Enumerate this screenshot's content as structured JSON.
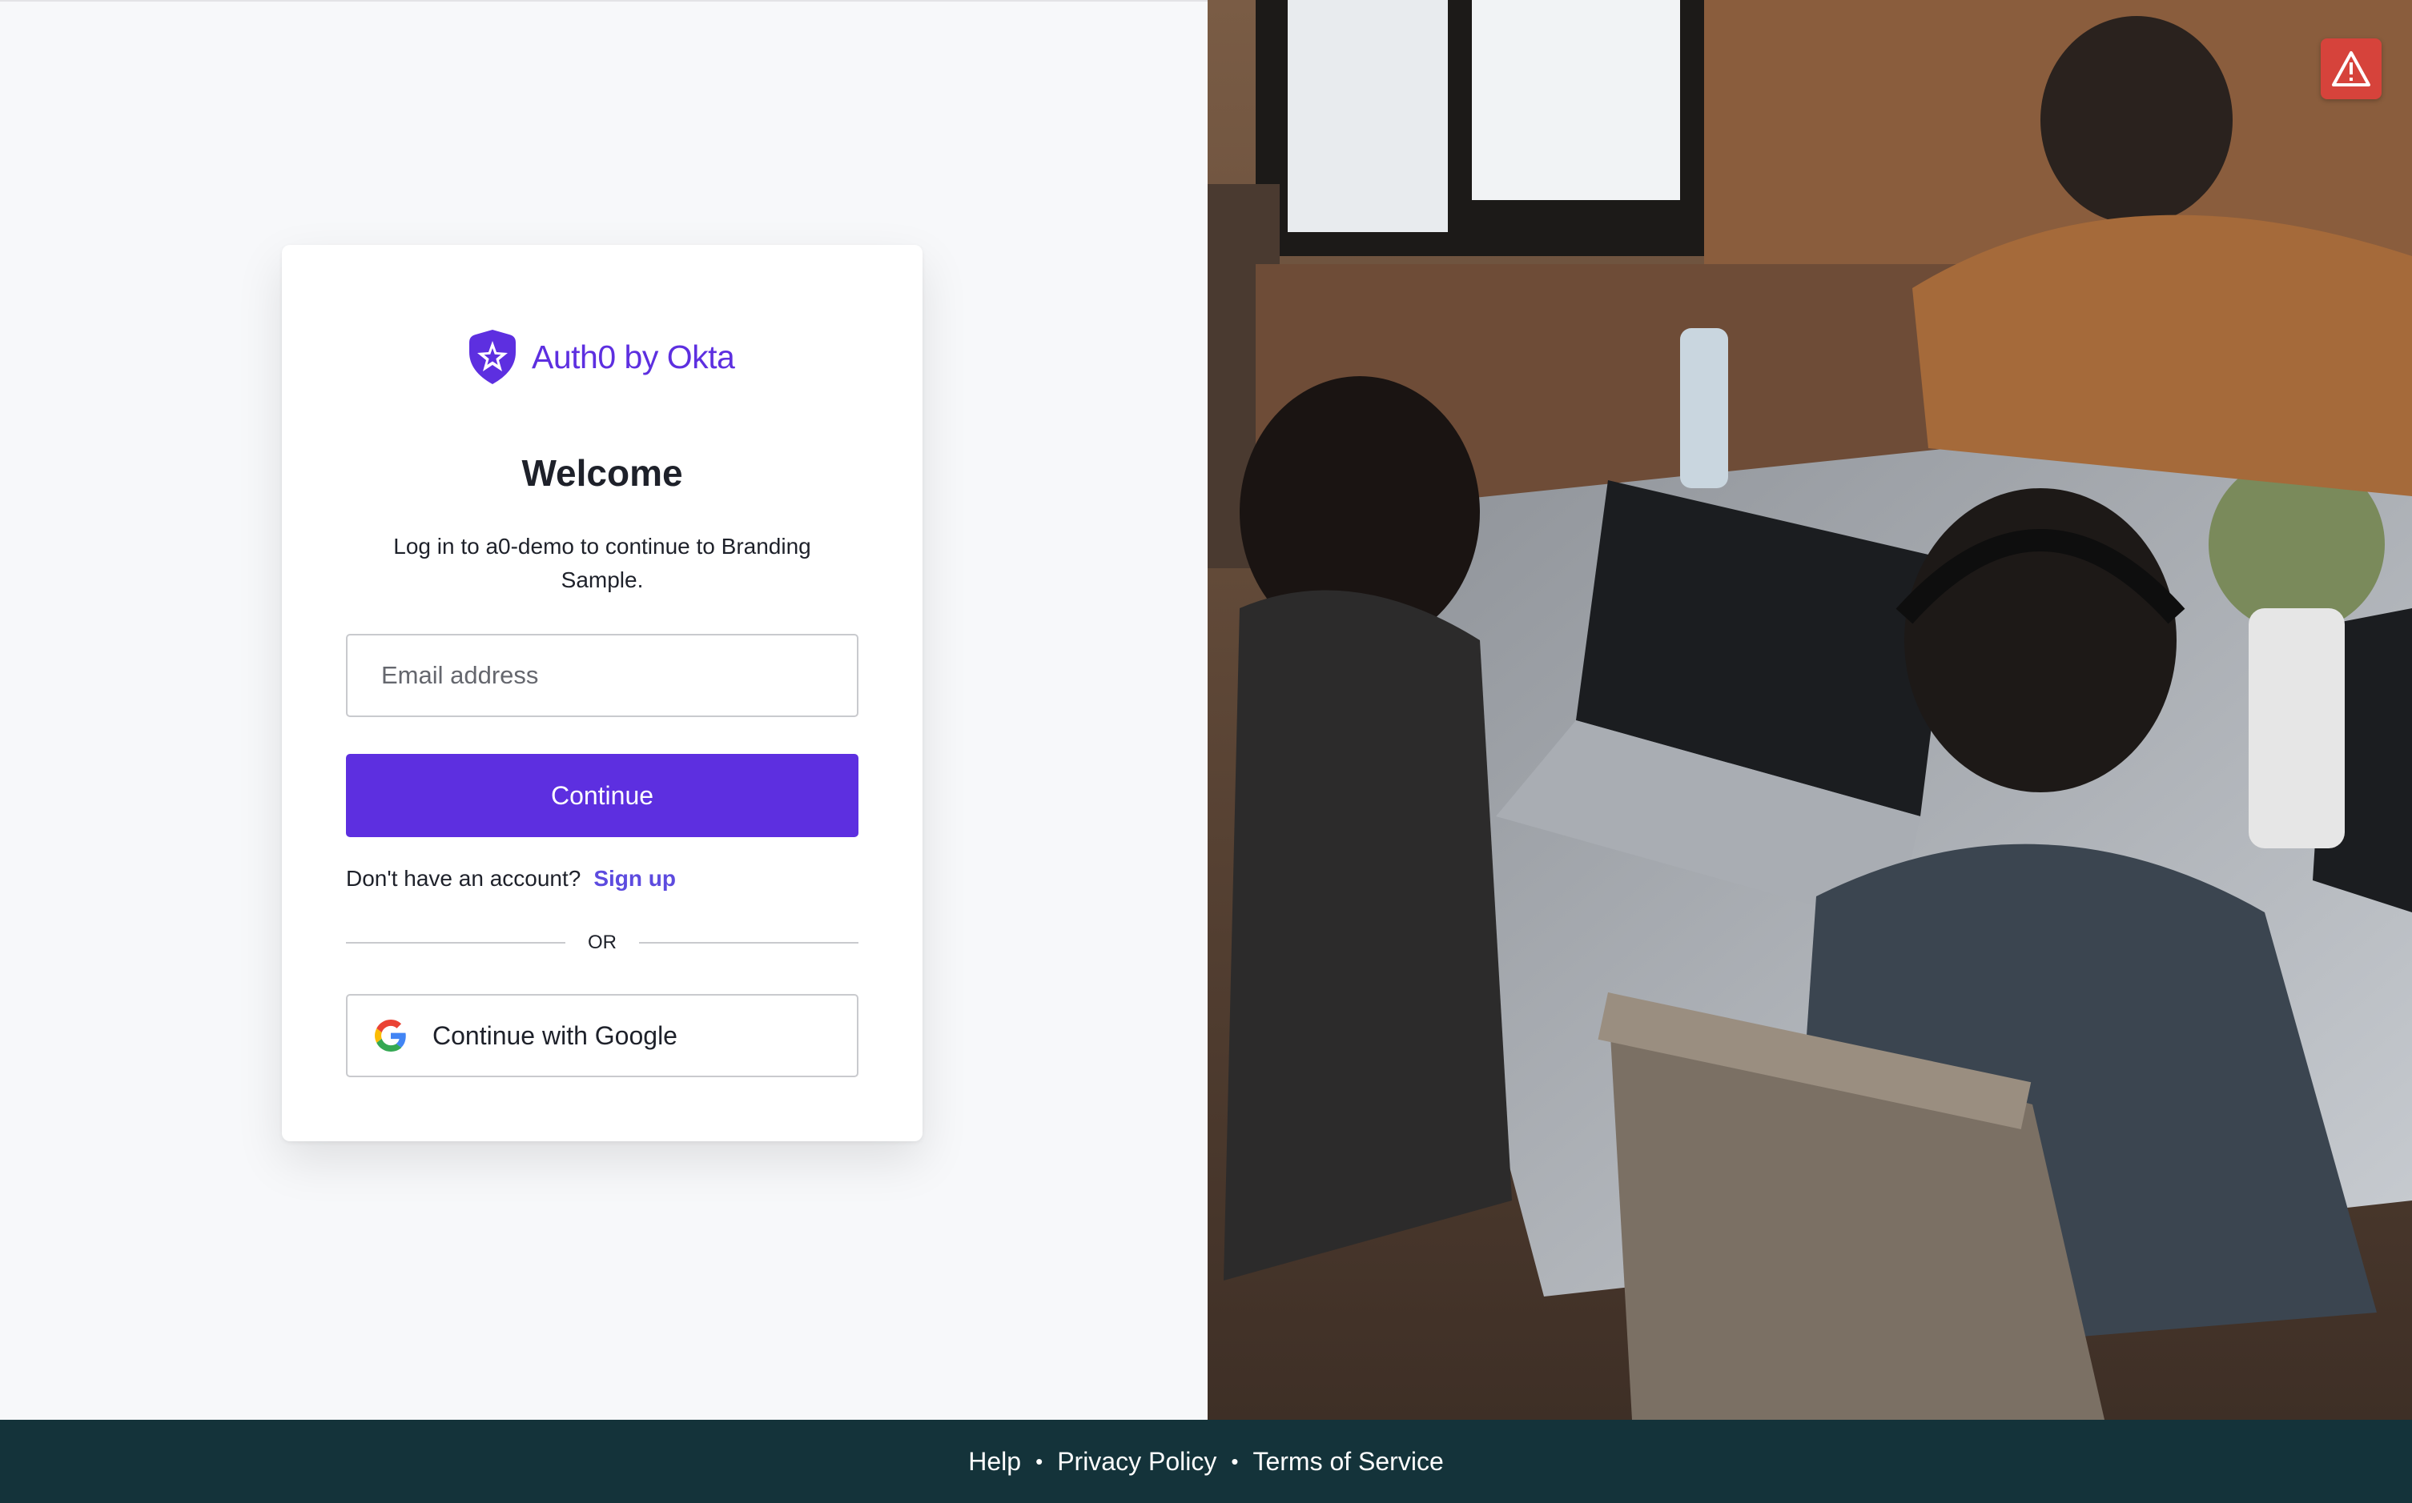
{
  "brand": {
    "name": "Auth0 by Okta",
    "accent_color": "#5d2fe0",
    "logo_icon": "auth0-shield-icon"
  },
  "login": {
    "title": "Welcome",
    "subtitle": "Log in to a0-demo to continue to Branding Sample.",
    "email_placeholder": "Email address",
    "email_value": "",
    "continue_label": "Continue",
    "no_account_text": "Don't have an account?",
    "signup_label": "Sign up",
    "divider_text": "OR",
    "google_label": "Continue with Google",
    "google_icon": "google-icon"
  },
  "alert": {
    "icon": "warning-icon",
    "color": "#d6433b"
  },
  "background_image": {
    "description_icon": "office-photo-image"
  },
  "footer": {
    "background_color": "#14333a",
    "links": [
      "Help",
      "Privacy Policy",
      "Terms of Service"
    ]
  }
}
